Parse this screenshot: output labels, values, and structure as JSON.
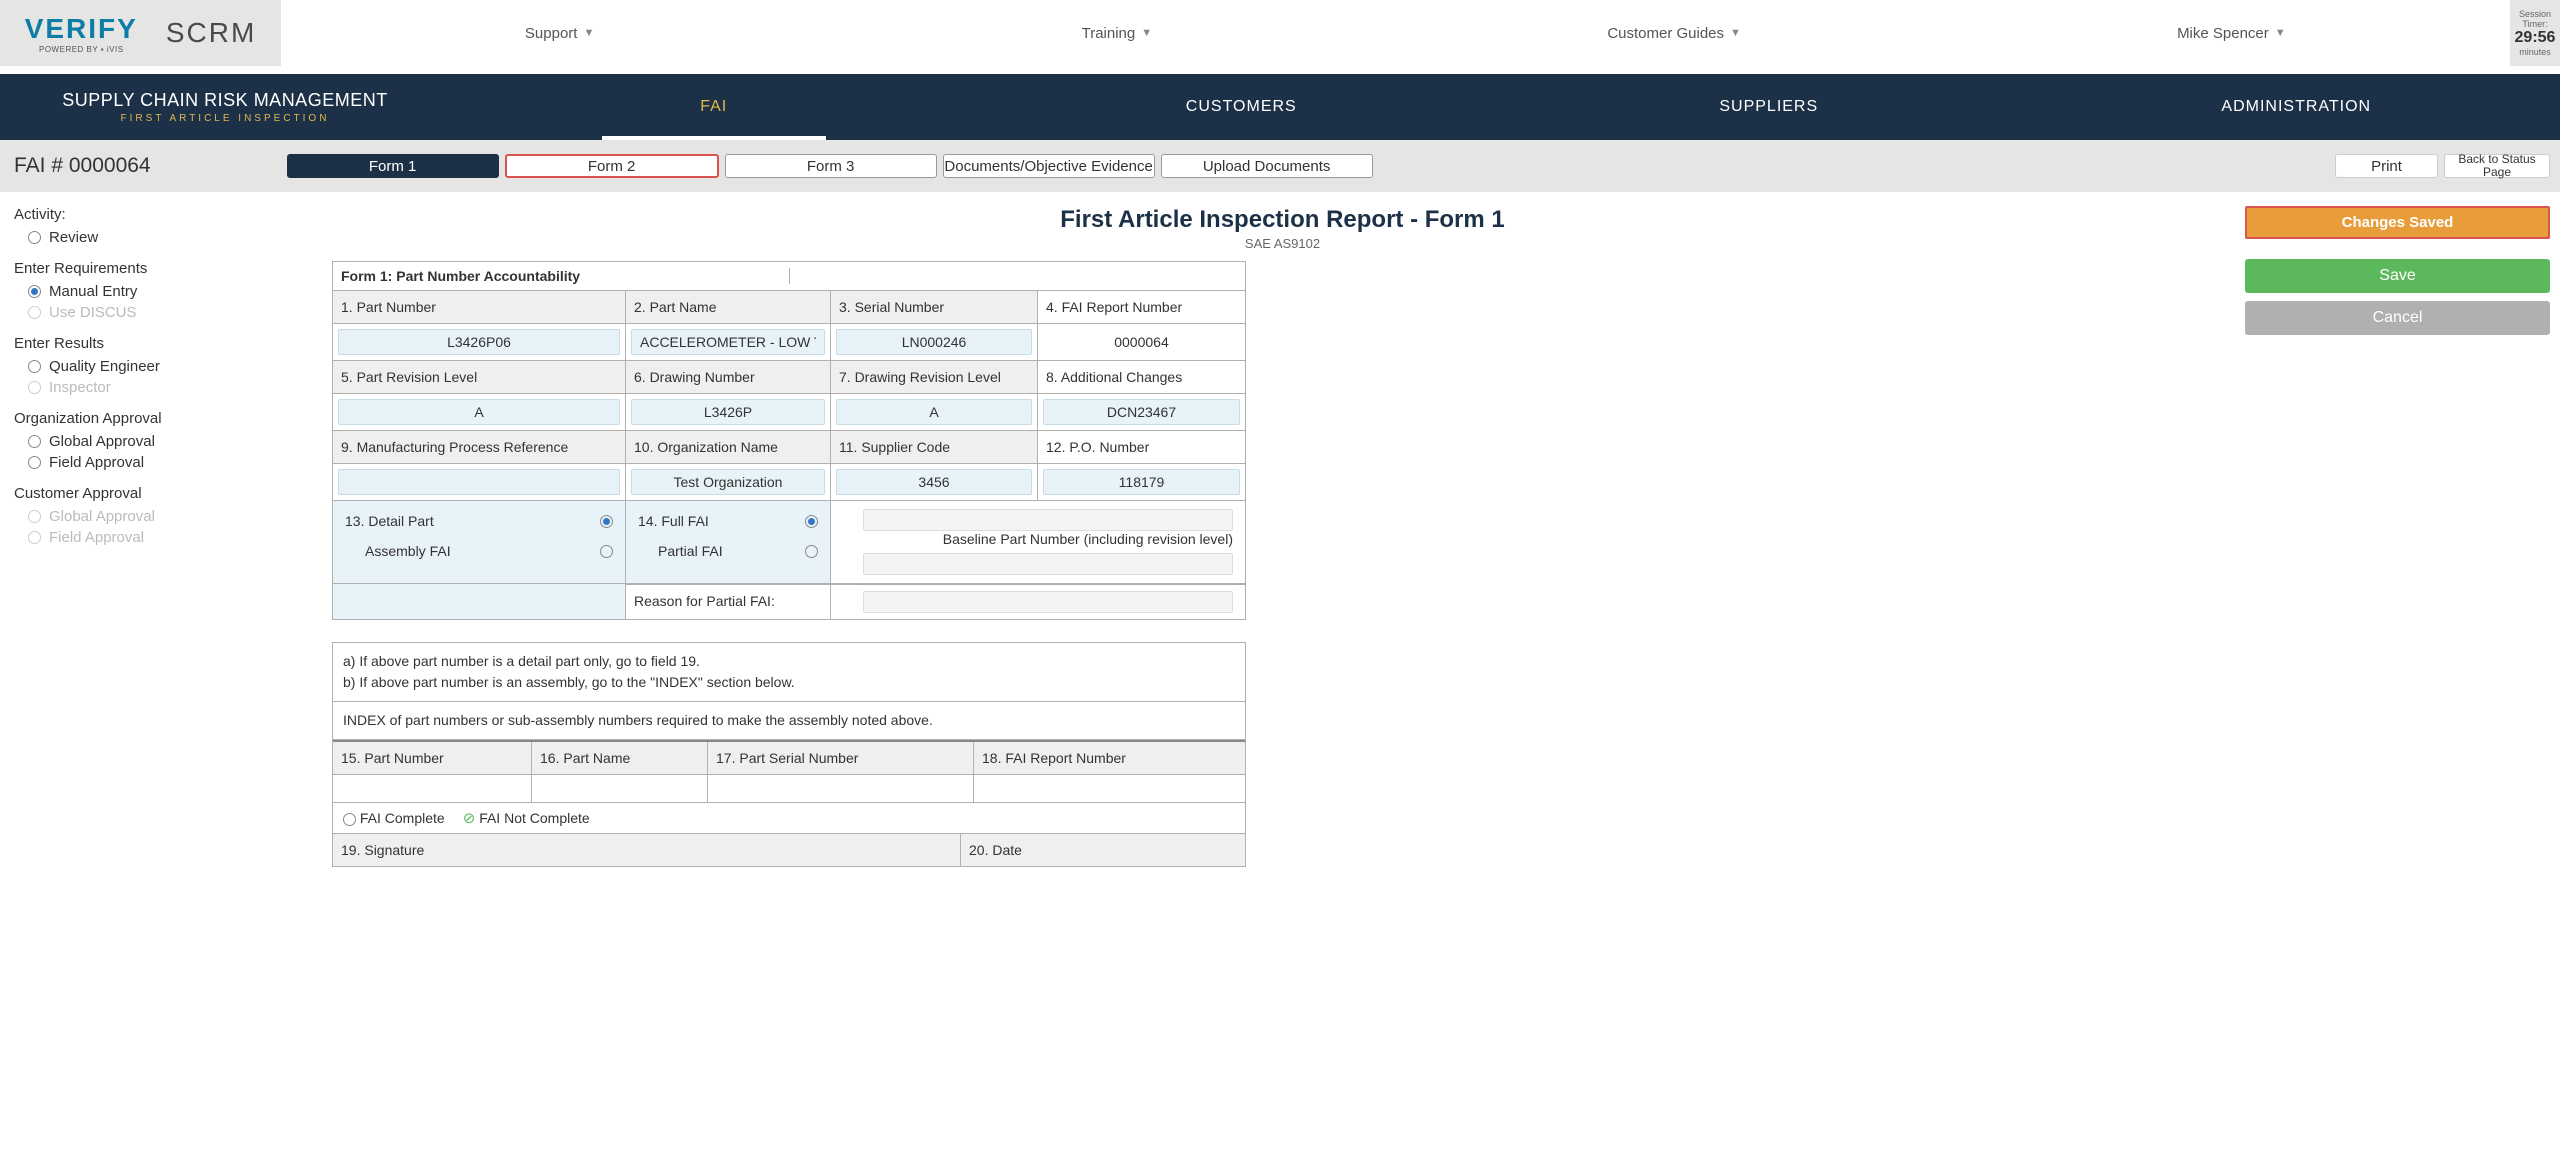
{
  "logo": {
    "verify": "VERIFY",
    "powered": "POWERED BY ▪ iVIS",
    "scrm": "SCRM"
  },
  "topnav": {
    "support": "Support",
    "training": "Training",
    "guides": "Customer Guides",
    "user": "Mike Spencer"
  },
  "session": {
    "label1": "Session",
    "label2": "Timer:",
    "time": "29:56",
    "unit": "minutes"
  },
  "navy": {
    "title": "SUPPLY CHAIN RISK MANAGEMENT",
    "sub": "FIRST ARTICLE INSPECTION",
    "tabs": [
      "FAI",
      "CUSTOMERS",
      "SUPPLIERS",
      "ADMINISTRATION"
    ]
  },
  "toolbar": {
    "fai_id": "FAI # 0000064",
    "form1": "Form 1",
    "form2": "Form 2",
    "form3": "Form 3",
    "docs": "Documents/Objective Evidence",
    "upload": "Upload Documents",
    "print": "Print",
    "back": "Back to Status Page"
  },
  "page": {
    "title": "First Article Inspection Report - Form 1",
    "sub": "SAE AS9102"
  },
  "sidebar": {
    "activity": "Activity:",
    "review": "Review",
    "enter_req": "Enter Requirements",
    "manual": "Manual Entry",
    "discus": "Use DISCUS",
    "enter_res": "Enter Results",
    "qe": "Quality Engineer",
    "inspector": "Inspector",
    "org_app": "Organization Approval",
    "global": "Global Approval",
    "field": "Field Approval",
    "cust_app": "Customer Approval"
  },
  "form": {
    "header": "Form 1: Part Number Accountability",
    "f1": "1. Part Number",
    "f1v": "L3426P06",
    "f2": "2. Part Name",
    "f2v": "ACCELEROMETER - LOW TEMPE",
    "f3": "3. Serial Number",
    "f3v": "LN000246",
    "f4": "4. FAI Report Number",
    "f4v": "0000064",
    "f5": "5. Part Revision Level",
    "f5v": "A",
    "f6": "6. Drawing Number",
    "f6v": "L3426P",
    "f7": "7. Drawing Revision Level",
    "f7v": "A",
    "f8": "8. Additional Changes",
    "f8v": "DCN23467",
    "f9": "9. Manufacturing Process Reference",
    "f9v": "",
    "f10": "10. Organization Name",
    "f10v": "Test Organization",
    "f11": "11. Supplier Code",
    "f11v": "3456",
    "f12": "12. P.O. Number",
    "f12v": "118179",
    "f13": "13. Detail Part",
    "f13b": "Assembly FAI",
    "f14": "14. Full FAI",
    "f14b": "Partial FAI",
    "baseline": "Baseline Part Number (including revision level)",
    "reason": "Reason for Partial FAI:",
    "note_a": "a) If above part number is a detail part only, go to field 19.",
    "note_b": "b) If above part number is an assembly, go to the \"INDEX\" section below.",
    "index_title": "INDEX of part numbers or sub-assembly numbers required to make the assembly noted above.",
    "f15": "15. Part Number",
    "f16": "16. Part Name",
    "f17": "17. Part Serial Number",
    "f18": "18. FAI Report Number",
    "complete": "FAI Complete",
    "not_complete": "FAI Not Complete",
    "f19": "19. Signature",
    "f20": "20. Date"
  },
  "right": {
    "status": "Changes Saved",
    "save": "Save",
    "cancel": "Cancel"
  }
}
